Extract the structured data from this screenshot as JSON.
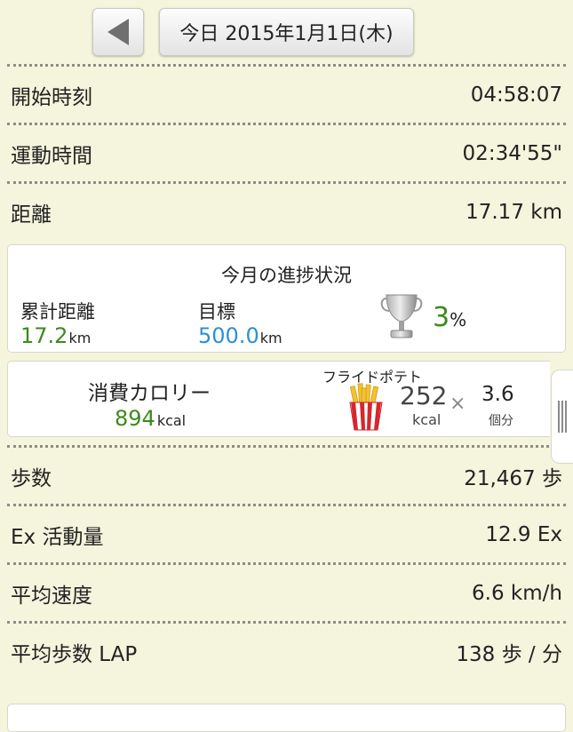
{
  "header": {
    "back_label": "◀",
    "date_label": "今日 2015年1月1日(木)"
  },
  "stats_top": [
    {
      "label": "開始時刻",
      "value": "04:58:07"
    },
    {
      "label": "運動時間",
      "value": "02:34'55\""
    },
    {
      "label": "距離",
      "value": "17.17 km"
    }
  ],
  "progress": {
    "title": "今月の進捗状況",
    "total_label": "累計距離",
    "total_value": "17.2",
    "total_unit": "km",
    "goal_label": "目標",
    "goal_value": "500.0",
    "goal_unit": "km",
    "percent": "3",
    "percent_sign": "%",
    "percent_fraction": 0.03,
    "trophy_icon": "trophy-icon",
    "colors": {
      "achieved": "#3c8a1c",
      "goal": "#2d8fd6"
    }
  },
  "calories": {
    "title": "消費カロリー",
    "value": "894",
    "unit": "kcal",
    "food_name": "フライドポテト",
    "food_icon": "french-fries-icon",
    "food_kcal": "252",
    "food_kcal_unit": "kcal",
    "times": "×",
    "count": "3.6",
    "count_unit": "個分"
  },
  "stats_bottom": [
    {
      "label": "歩数",
      "value": "21,467 歩"
    },
    {
      "label": "Ex 活動量",
      "value": "12.9 Ex"
    },
    {
      "label": "平均速度",
      "value": "6.6 km/h"
    },
    {
      "label": "平均歩数 LAP",
      "value": "138 歩 / 分"
    }
  ]
}
